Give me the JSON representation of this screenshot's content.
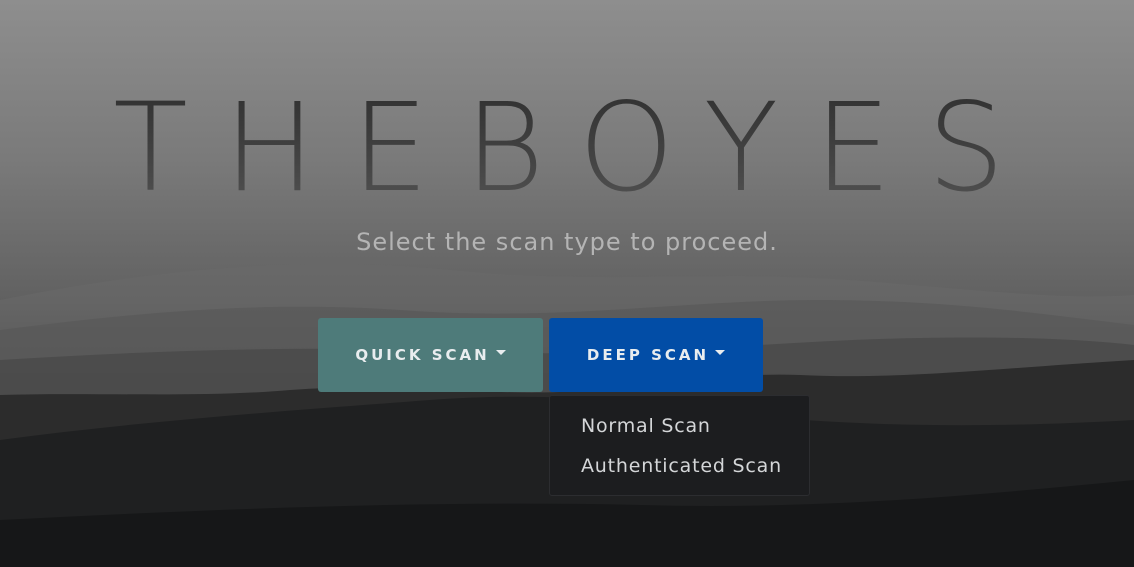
{
  "hero": {
    "title": "THEBOYES",
    "subtitle": "Select the scan type to proceed."
  },
  "buttons": {
    "quick_scan": {
      "label": "QUICK SCAN",
      "color": "#4e7b7a",
      "icon": "caret-down-icon"
    },
    "deep_scan": {
      "label": "DEEP SCAN",
      "color": "#024da6",
      "icon": "caret-down-icon"
    }
  },
  "deep_scan_menu": {
    "open": true,
    "items": [
      {
        "label": "Normal Scan"
      },
      {
        "label": "Authenticated Scan"
      }
    ]
  }
}
